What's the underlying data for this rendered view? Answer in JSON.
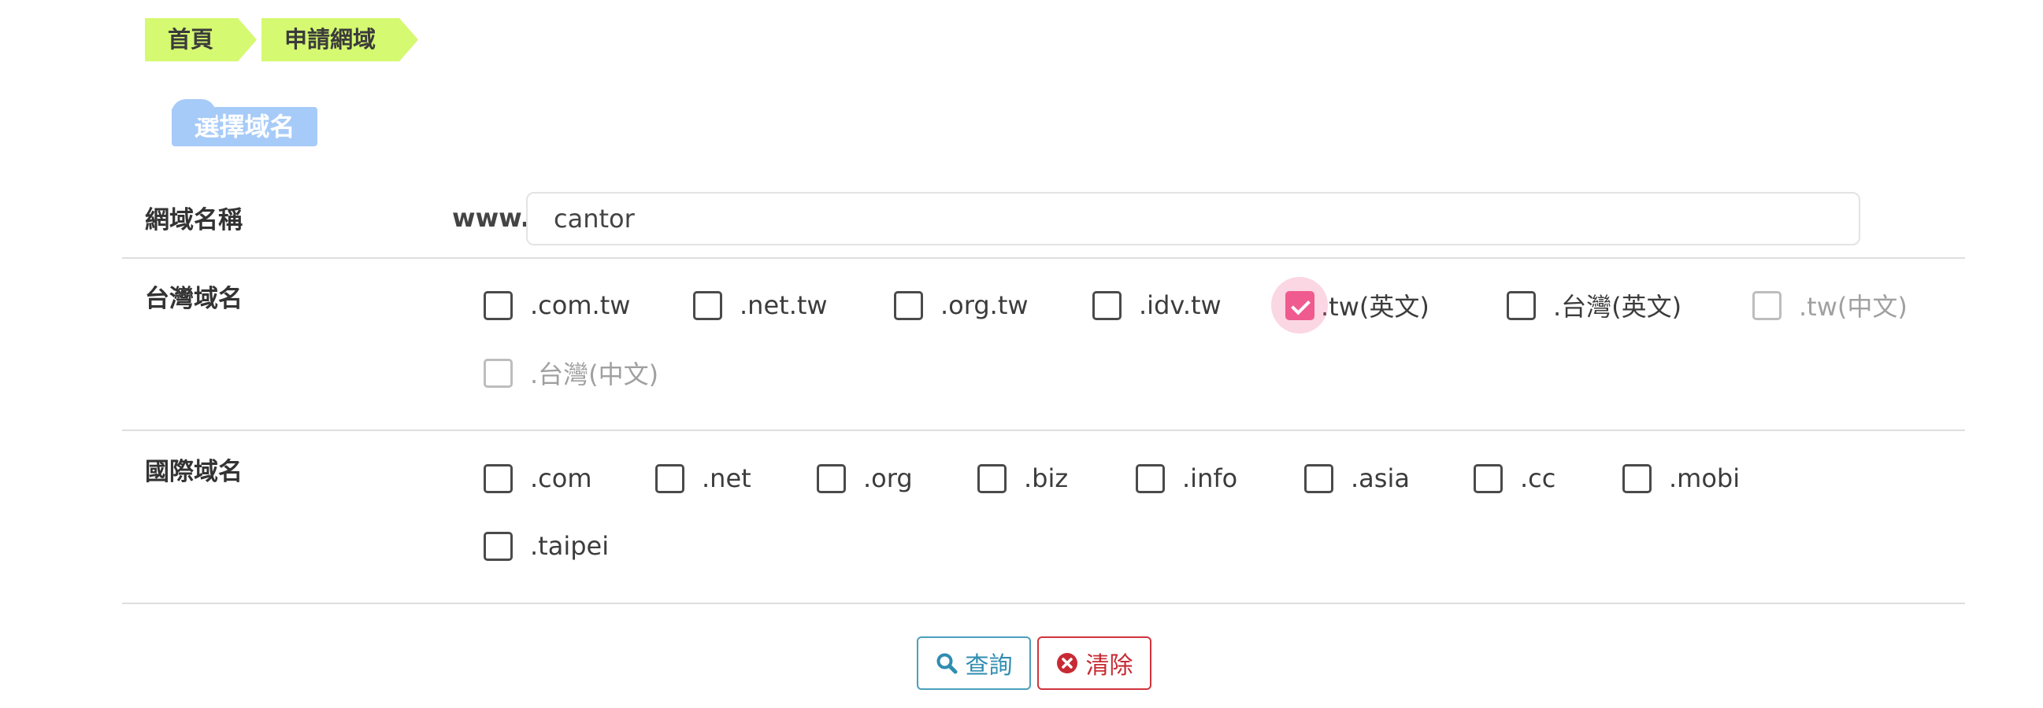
{
  "breadcrumb": {
    "home": "首頁",
    "current": "申請網域"
  },
  "section_title": "選擇域名",
  "domain_row": {
    "label": "網域名稱",
    "prefix": "www.",
    "value": "cantor",
    "placeholder": ""
  },
  "tw_row": {
    "label": "台灣域名",
    "options": [
      {
        "label": ".com.tw",
        "checked": false,
        "disabled": false
      },
      {
        "label": ".net.tw",
        "checked": false,
        "disabled": false
      },
      {
        "label": ".org.tw",
        "checked": false,
        "disabled": false
      },
      {
        "label": ".idv.tw",
        "checked": false,
        "disabled": false
      },
      {
        "label": ".tw(英文)",
        "checked": true,
        "disabled": false
      },
      {
        "label": ".台灣(英文)",
        "checked": false,
        "disabled": false
      },
      {
        "label": ".tw(中文)",
        "checked": false,
        "disabled": true
      },
      {
        "label": ".台灣(中文)",
        "checked": false,
        "disabled": true
      }
    ]
  },
  "intl_row": {
    "label": "國際域名",
    "options": [
      {
        "label": ".com",
        "checked": false,
        "disabled": false
      },
      {
        "label": ".net",
        "checked": false,
        "disabled": false
      },
      {
        "label": ".org",
        "checked": false,
        "disabled": false
      },
      {
        "label": ".biz",
        "checked": false,
        "disabled": false
      },
      {
        "label": ".info",
        "checked": false,
        "disabled": false
      },
      {
        "label": ".asia",
        "checked": false,
        "disabled": false
      },
      {
        "label": ".cc",
        "checked": false,
        "disabled": false
      },
      {
        "label": ".mobi",
        "checked": false,
        "disabled": false
      },
      {
        "label": ".taipei",
        "checked": false,
        "disabled": false
      }
    ]
  },
  "actions": {
    "search_label": "查詢",
    "clear_label": "清除",
    "search_icon": "search-icon",
    "clear_icon": "close-circle-icon"
  },
  "colors": {
    "breadcrumb_bg": "#d5f971",
    "section_tag_bg": "#a7cbf8",
    "checked": "#ef5a8f",
    "search": "#2f8db0",
    "clear": "#c82a33"
  }
}
